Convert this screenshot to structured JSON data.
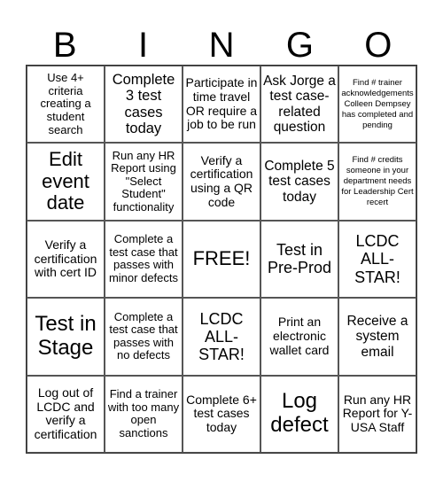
{
  "header": [
    "B",
    "I",
    "N",
    "G",
    "O"
  ],
  "cells": [
    [
      "Use 4+ criteria creating a student search",
      "Complete 3 test cases today",
      "Participate in time travel OR require a job to be run",
      "Ask Jorge a test case-related question",
      "Find # trainer acknowledgements Colleen Dempsey has completed and pending"
    ],
    [
      "Edit event date",
      "Run any HR Report using \"Select Student\" functionality",
      "Verify a certification using a QR code",
      "Complete 5 test cases today",
      "Find # credits someone in your department needs for Leadership Cert recert"
    ],
    [
      "Verify a certification with cert ID",
      "Complete a test case that passes with minor defects",
      "FREE!",
      "Test in Pre-Prod",
      "LCDC ALL-STAR!"
    ],
    [
      "Test in Stage",
      "Complete a test case that passes with no defects",
      "LCDC ALL-STAR!",
      "Print an electronic wallet card",
      "Receive a system email"
    ],
    [
      "Log out of LCDC and verify a certification",
      "Find a trainer with too many open sanctions",
      "Complete 6+ test cases today",
      "Log defect",
      "Run any HR Report for Y-USA Staff"
    ]
  ]
}
